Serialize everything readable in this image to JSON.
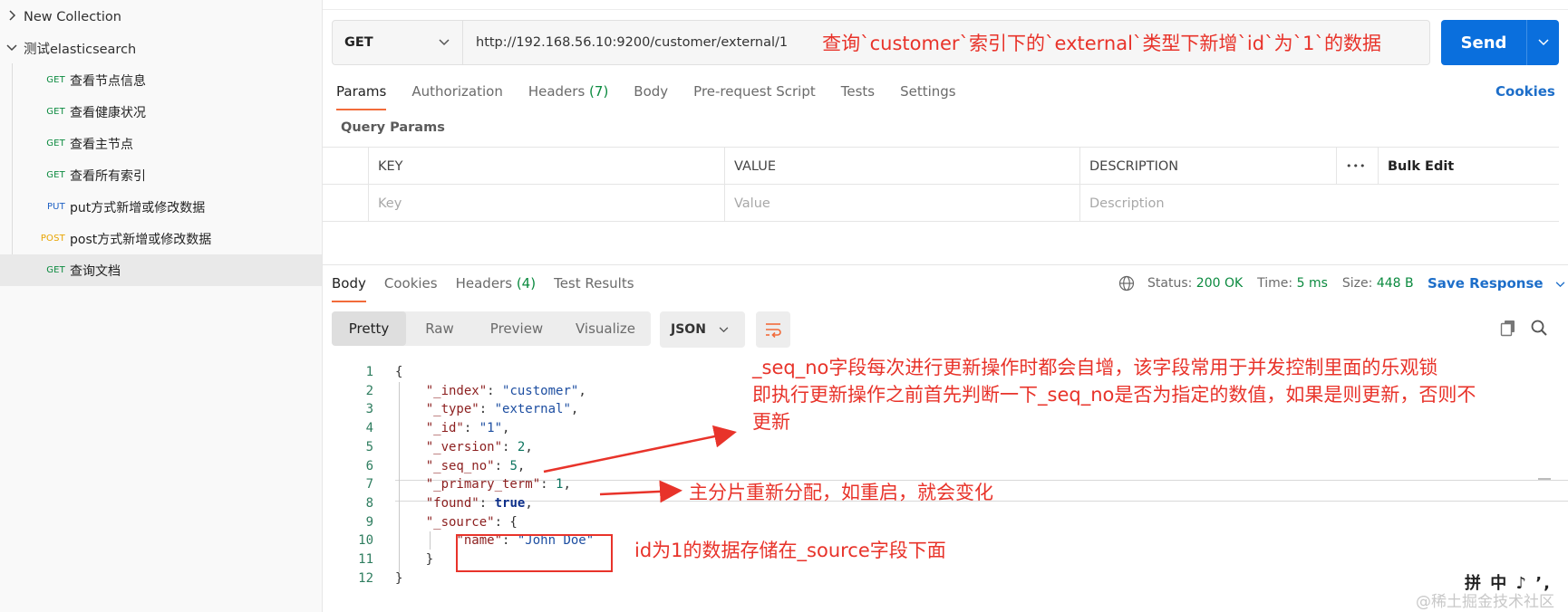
{
  "sidebar": {
    "collections": [
      {
        "label": "New Collection",
        "expanded": false
      },
      {
        "label": "测试elasticsearch",
        "expanded": true
      }
    ],
    "requests": [
      {
        "method": "GET",
        "label": "查看节点信息",
        "selected": false
      },
      {
        "method": "GET",
        "label": "查看健康状况",
        "selected": false
      },
      {
        "method": "GET",
        "label": "查看主节点",
        "selected": false
      },
      {
        "method": "GET",
        "label": "查看所有索引",
        "selected": false
      },
      {
        "method": "PUT",
        "label": "put方式新增或修改数据",
        "selected": false
      },
      {
        "method": "POST",
        "label": "post方式新增或修改数据",
        "selected": false
      },
      {
        "method": "GET",
        "label": "查询文档",
        "selected": true
      }
    ]
  },
  "request": {
    "method": "GET",
    "url": "http://192.168.56.10:9200/customer/external/1",
    "send_label": "Send",
    "tabs": [
      {
        "label": "Params",
        "count": "",
        "active": true
      },
      {
        "label": "Authorization",
        "count": "",
        "active": false
      },
      {
        "label": "Headers",
        "count": "(7)",
        "active": false
      },
      {
        "label": "Body",
        "count": "",
        "active": false
      },
      {
        "label": "Pre-request Script",
        "count": "",
        "active": false
      },
      {
        "label": "Tests",
        "count": "",
        "active": false
      },
      {
        "label": "Settings",
        "count": "",
        "active": false
      }
    ],
    "cookies_label": "Cookies",
    "query_params_title": "Query Params",
    "params_table": {
      "headers": [
        "KEY",
        "VALUE",
        "DESCRIPTION",
        "•••",
        "Bulk Edit"
      ],
      "placeholders": [
        "Key",
        "Value",
        "Description"
      ]
    }
  },
  "response": {
    "tabs": [
      {
        "label": "Body",
        "count": "",
        "active": true
      },
      {
        "label": "Cookies",
        "count": "",
        "active": false
      },
      {
        "label": "Headers",
        "count": "(4)",
        "active": false
      },
      {
        "label": "Test Results",
        "count": "",
        "active": false
      }
    ],
    "status_label": "Status:",
    "status_value": "200 OK",
    "time_label": "Time:",
    "time_value": "5 ms",
    "size_label": "Size:",
    "size_value": "448 B",
    "save_label": "Save Response",
    "view_modes": [
      "Pretty",
      "Raw",
      "Preview",
      "Visualize"
    ],
    "active_view": "Pretty",
    "format": "JSON",
    "code_lines": [
      "{",
      "    \"_index\": \"customer\",",
      "    \"_type\": \"external\",",
      "    \"_id\": \"1\",",
      "    \"_version\": 2,",
      "    \"_seq_no\": 5,",
      "    \"_primary_term\": 1,",
      "    \"found\": true,",
      "    \"_source\": {",
      "        \"name\": \"John Doe\"",
      "    }",
      "}"
    ]
  },
  "annotations": {
    "url_note": "查询`customer`索引下的`external`类型下新增`id`为`1`的数据",
    "seq_no_note_1": "_seq_no字段每次进行更新操作时都会自增，该字段常用于并发控制里面的乐观锁",
    "seq_no_note_2": "即执行更新操作之前首先判断一下_seq_no是否为指定的数值，如果是则更新，否则不",
    "seq_no_note_3": "更新",
    "primary_term_note": "主分片重新分配，如重启，就会变化",
    "source_note": "id为1的数据存储在_source字段下面",
    "color": "#e8332a"
  },
  "overlay": {
    "watermark": "@稀土掘金技术社区",
    "ime": "拼 中 ♪ ’,"
  },
  "colors": {
    "send_button": "#0a6fdd",
    "active_tab_underline": "#f26b3a",
    "get_method": "#0b8a3f",
    "put_method": "#1f61c4",
    "post_method": "#e8a400",
    "link": "#1d6ec9"
  }
}
